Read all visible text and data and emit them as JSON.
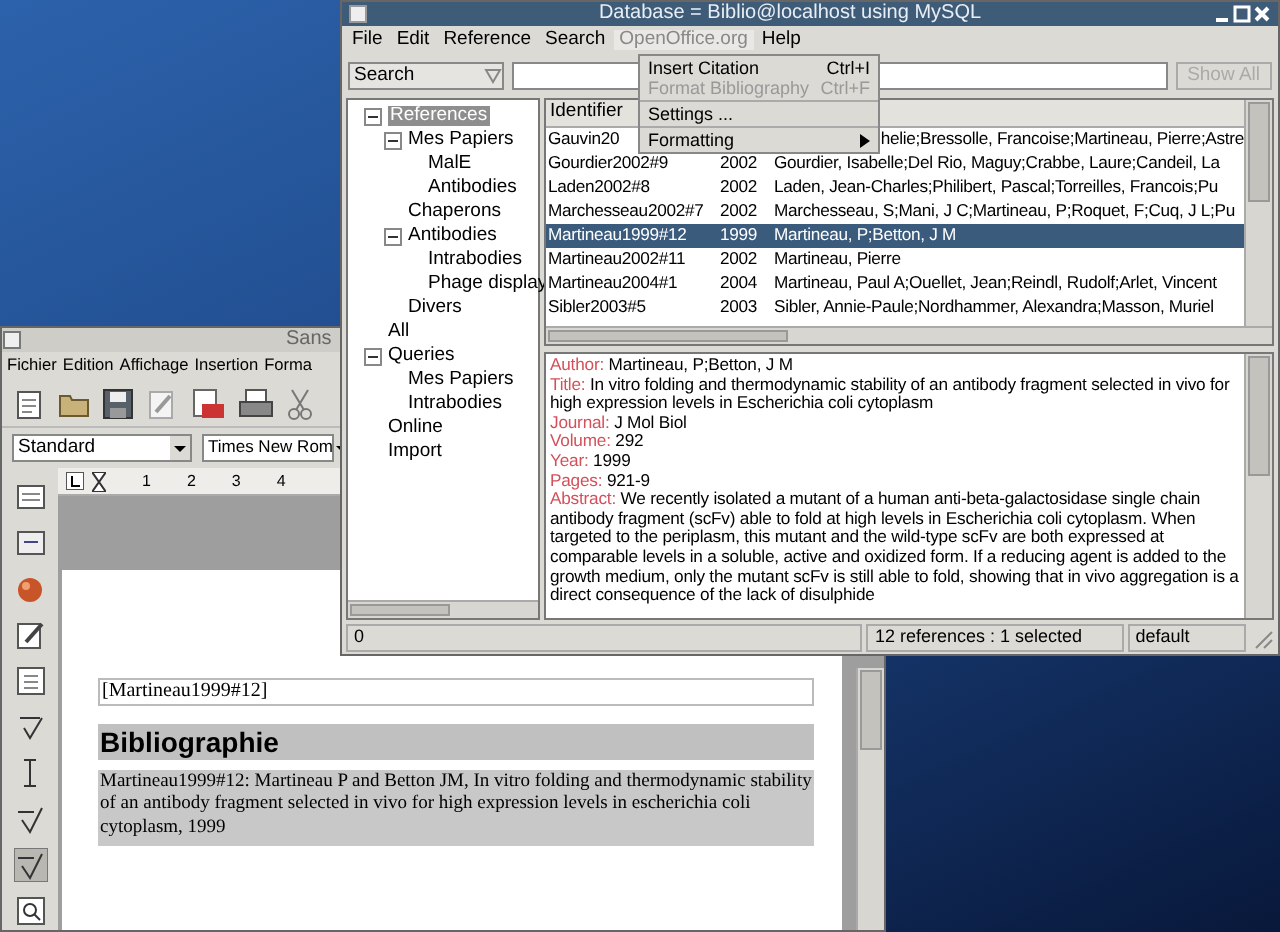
{
  "writer_window": {
    "title": "Sans",
    "menu": [
      "Fichier",
      "Edition",
      "Affichage",
      "Insertion",
      "Forma"
    ],
    "paragraph_style": "Standard",
    "font_name": "Times New Rom",
    "ruler_marks": [
      "1",
      "2",
      "3",
      "4"
    ],
    "document": {
      "field": "[Martineau1999#12]",
      "heading": "Bibliographie",
      "entry": "Martineau1999#12: Martineau P and Betton JM, In vitro folding and thermodynamic stability of an antibody fragment selected in vivo for high expression levels in escherichia coli cytoplasm, 1999"
    }
  },
  "database_window": {
    "title": "Database = Biblio@localhost using MySQL",
    "menu": [
      {
        "label": "File",
        "open": false
      },
      {
        "label": "Edit",
        "open": false
      },
      {
        "label": "Reference",
        "open": false
      },
      {
        "label": "Search",
        "open": false
      },
      {
        "label": "OpenOffice.org",
        "open": true
      },
      {
        "label": "Help",
        "open": false
      }
    ],
    "open_menu": [
      {
        "kind": "item",
        "label": "Insert Citation",
        "shortcut": "Ctrl+I",
        "disabled": false
      },
      {
        "kind": "item",
        "label": "Format Bibliography",
        "shortcut": "Ctrl+F",
        "disabled": true
      },
      {
        "kind": "separator"
      },
      {
        "kind": "item",
        "label": "Settings ...",
        "disabled": false
      },
      {
        "kind": "separator"
      },
      {
        "kind": "submenu",
        "label": "Formatting",
        "disabled": false
      }
    ],
    "search": {
      "field": "Search",
      "button": {
        "label": "Show All",
        "disabled": true
      }
    },
    "tree": [
      {
        "label": "References",
        "selected": true,
        "expanded": true,
        "children": [
          {
            "label": "Mes Papiers",
            "selected": false,
            "expanded": true,
            "children": [
              {
                "label": "MalE",
                "selected": false
              },
              {
                "label": "Antibodies",
                "selected": false
              }
            ]
          },
          {
            "label": "Chaperons",
            "selected": false
          },
          {
            "label": "Antibodies",
            "selected": false,
            "expanded": true,
            "children": [
              {
                "label": "Intrabodies",
                "selected": false
              },
              {
                "label": "Phage display",
                "selected": false
              }
            ]
          },
          {
            "label": "Divers",
            "selected": false
          }
        ]
      },
      {
        "label": "All",
        "selected": false
      },
      {
        "label": "Queries",
        "selected": false,
        "expanded": true,
        "children": [
          {
            "label": "Mes Papiers",
            "selected": false
          },
          {
            "label": "Intrabodies",
            "selected": false
          }
        ]
      },
      {
        "label": "Online",
        "selected": false
      },
      {
        "label": "Import",
        "selected": false
      }
    ],
    "table": {
      "columns": [
        "Identifier"
      ],
      "rows": [
        {
          "kind": "partial",
          "identifier": "Gauvin20",
          "authors": "helie;Bressolle, Francoise;Martineau, Pierre;Astre",
          "selected": false
        },
        {
          "kind": "full",
          "identifier": "Gourdier2002#9",
          "year": "2002",
          "authors": "Gourdier, Isabelle;Del Rio, Maguy;Crabbe, Laure;Candeil, La",
          "selected": false
        },
        {
          "kind": "full",
          "identifier": "Laden2002#8",
          "year": "2002",
          "authors": "Laden, Jean-Charles;Philibert, Pascal;Torreilles, Francois;Pu",
          "selected": false
        },
        {
          "kind": "full",
          "identifier": "Marchesseau2002#7",
          "year": "2002",
          "authors": "Marchesseau, S;Mani, J C;Martineau, P;Roquet, F;Cuq, J L;Pu",
          "selected": false
        },
        {
          "kind": "full",
          "identifier": "Martineau1999#12",
          "year": "1999",
          "authors": "Martineau, P;Betton, J M",
          "selected": true
        },
        {
          "kind": "full",
          "identifier": "Martineau2002#11",
          "year": "2002",
          "authors": "Martineau, Pierre",
          "selected": false
        },
        {
          "kind": "full",
          "identifier": "Martineau2004#1",
          "year": "2004",
          "authors": "Martineau, Paul A;Ouellet, Jean;Reindl, Rudolf;Arlet, Vincent",
          "selected": false
        },
        {
          "kind": "full",
          "identifier": "Sibler2003#5",
          "year": "2003",
          "authors": "Sibler, Annie-Paule;Nordhammer, Alexandra;Masson, Muriel",
          "selected": false
        }
      ]
    },
    "details": [
      {
        "label": "Author:",
        "value": "Martineau, P;Betton, J M"
      },
      {
        "label": "Title:",
        "value": "In vitro folding and thermodynamic stability of an antibody fragment selected in vivo for high expression levels in Escherichia coli cytoplasm"
      },
      {
        "label": "Journal:",
        "value": "J Mol Biol"
      },
      {
        "label": "Volume:",
        "value": "292"
      },
      {
        "label": "Year:",
        "value": "1999"
      },
      {
        "label": "Pages:",
        "value": "921-9"
      },
      {
        "label": "Abstract:",
        "value": "We recently isolated a mutant of a human anti-beta-galactosidase single chain antibody fragment (scFv) able to fold at high levels in Escherichia coli cytoplasm. When targeted to the periplasm, this mutant and the wild-type scFv are both expressed at comparable levels in a soluble, active and oxidized form. If a reducing agent is added to the growth medium, only the mutant scFv is still able to fold, showing that in vivo aggregation is a direct consequence of the lack of disulphide"
      }
    ],
    "status_bar": [
      "0",
      "12 references : 1 selected",
      "default"
    ]
  }
}
